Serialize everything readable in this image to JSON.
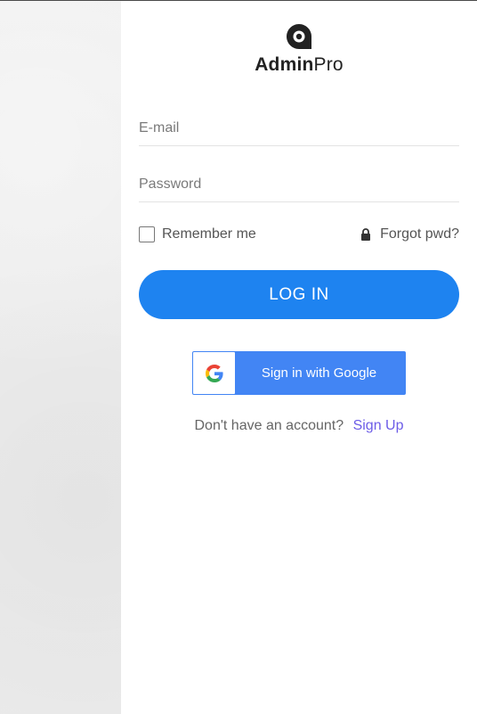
{
  "brand": {
    "name_bold": "Admin",
    "name_light": "Pro"
  },
  "form": {
    "email_placeholder": "E-mail",
    "password_placeholder": "Password",
    "remember_label": "Remember me",
    "forgot_label": "Forgot pwd?",
    "login_label": "LOG IN",
    "google_label": "Sign in with Google"
  },
  "signup": {
    "prompt": "Don't have an account?",
    "link_label": "Sign Up"
  },
  "colors": {
    "primary": "#1e83f0",
    "google_blue": "#4285f4",
    "link": "#6c5ce7"
  },
  "icons": {
    "logo": "logo-mark-icon",
    "lock": "lock-icon",
    "google": "google-g-icon"
  }
}
